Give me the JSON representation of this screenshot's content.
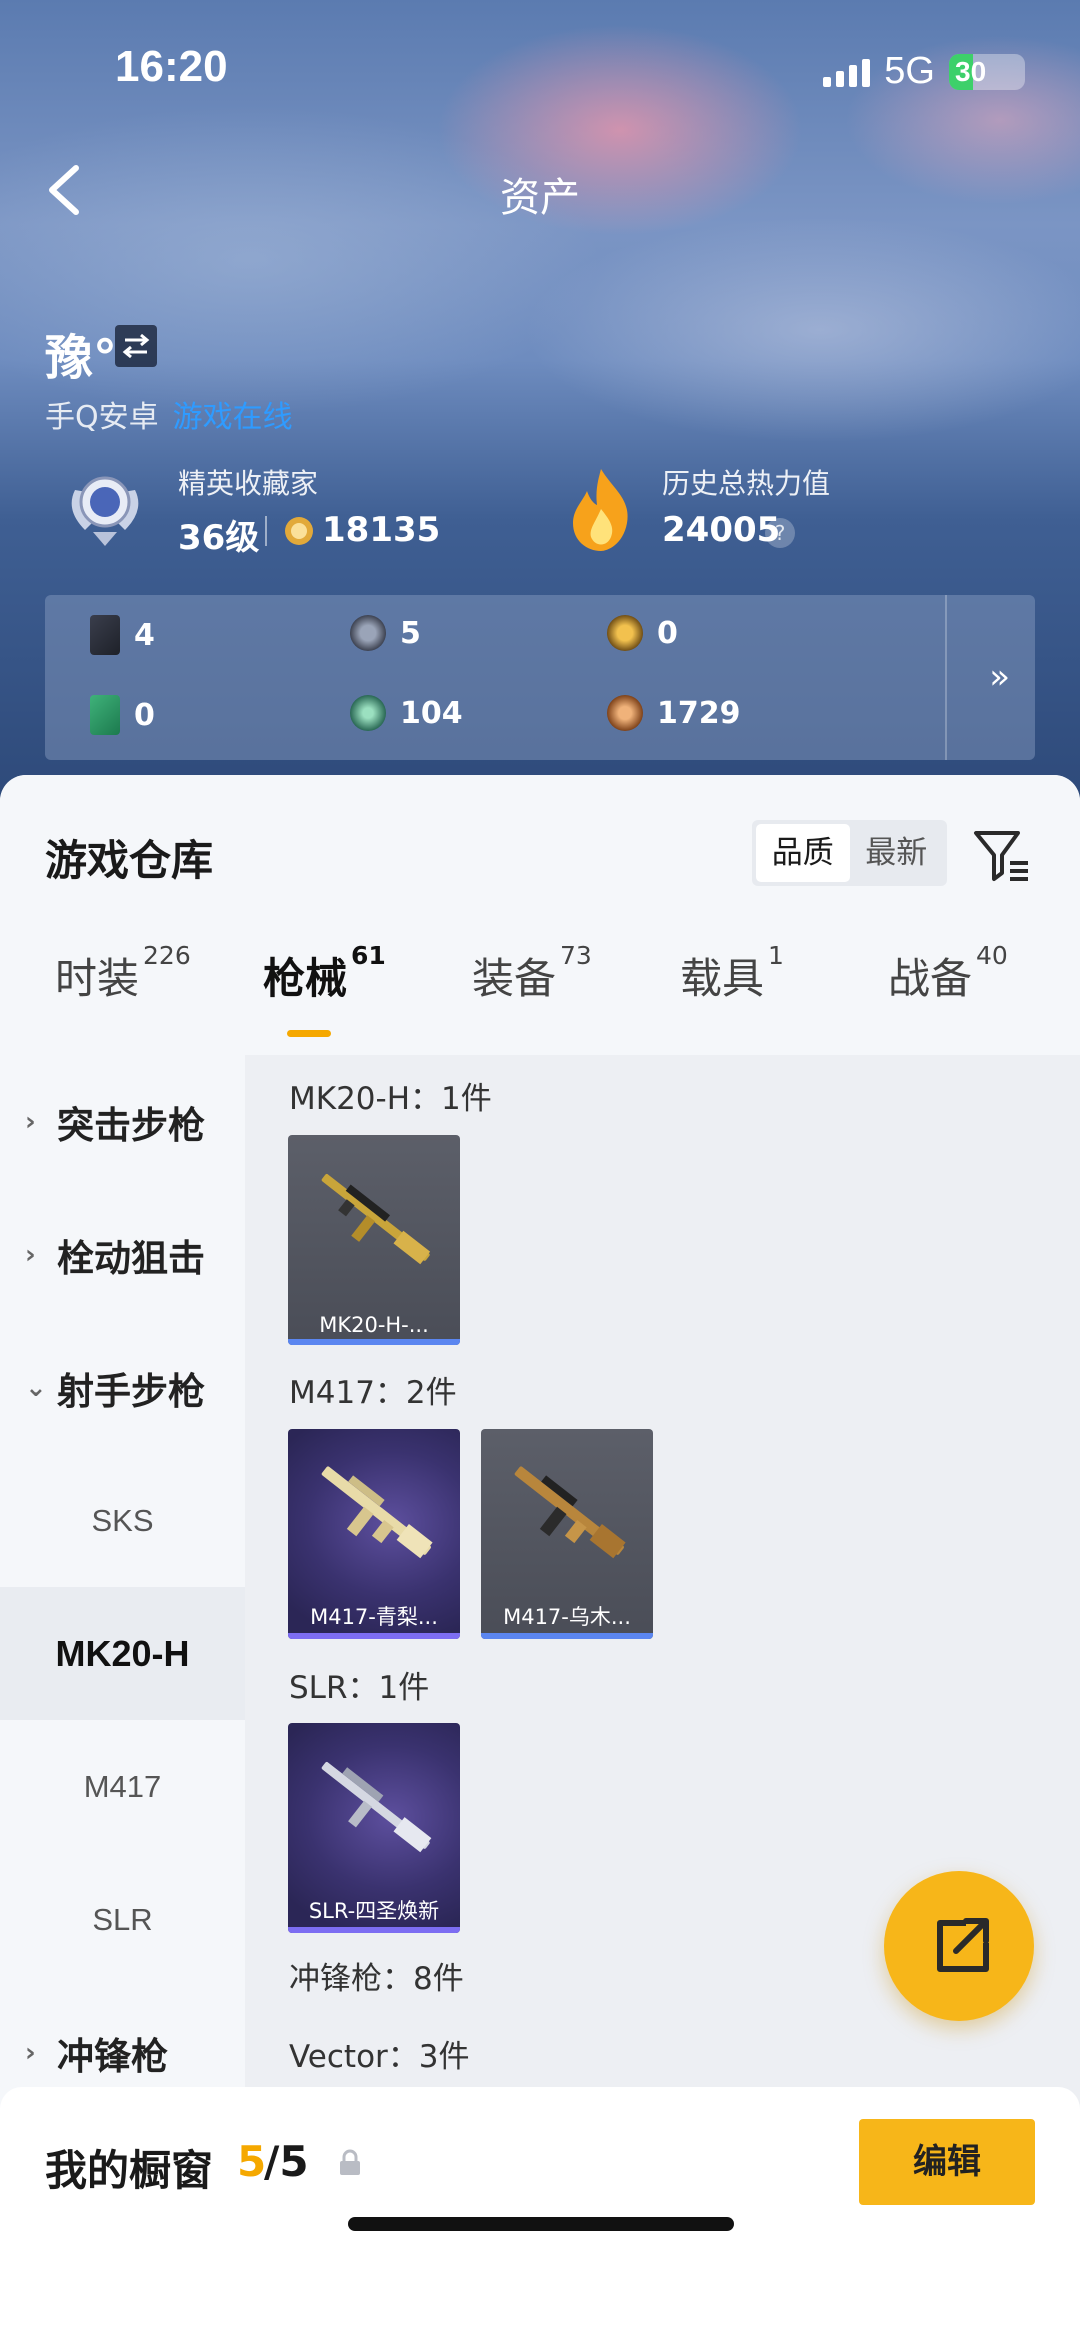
{
  "status_bar": {
    "time": "16:20",
    "network": "5G",
    "battery": "30"
  },
  "header": {
    "title": "资产"
  },
  "user": {
    "name": "豫°",
    "platform": "手Q安卓",
    "online_status": "游戏在线"
  },
  "collector": {
    "label": "精英收藏家",
    "level": "36级",
    "points": "18135"
  },
  "heat": {
    "label": "历史总热力值",
    "value": "24005",
    "help": "?"
  },
  "stats": [
    {
      "icon": "card-grey-icon",
      "value": "4"
    },
    {
      "icon": "silver-medal-icon",
      "value": "5"
    },
    {
      "icon": "gold-medal-icon",
      "value": "0"
    },
    {
      "icon": "card-green-icon",
      "value": "0"
    },
    {
      "icon": "green-orb-icon",
      "value": "104"
    },
    {
      "icon": "bronze-medal-icon",
      "value": "1729"
    }
  ],
  "stats_more": "»",
  "warehouse": {
    "title": "游戏仓库",
    "sort_options": [
      "品质",
      "最新"
    ],
    "sort_selected": "品质"
  },
  "tabs": [
    {
      "label": "时装",
      "count": "226"
    },
    {
      "label": "枪械",
      "count": "61"
    },
    {
      "label": "装备",
      "count": "73"
    },
    {
      "label": "载具",
      "count": "1"
    },
    {
      "label": "战备",
      "count": "40"
    }
  ],
  "active_tab": "枪械",
  "sidebar": {
    "assault": "突击步枪",
    "bolt": "栓动狙击",
    "marksman": "射手步枪",
    "sks": "SKS",
    "mk20": "MK20-H",
    "m417": "M417",
    "slr": "SLR",
    "smg": "冲锋枪"
  },
  "groups": {
    "mk20": "MK20-H：1件",
    "m417": "M417：2件",
    "slr": "SLR：1件",
    "smg": "冲锋枪：8件",
    "vector": "Vector：3件"
  },
  "items": {
    "mk20_1": "MK20-H-...",
    "m417_1": "M417-青梨...",
    "m417_2": "M417-乌木...",
    "slr_1": "SLR-四圣焕新"
  },
  "showcase": {
    "label": "我的橱窗",
    "count": "5",
    "total": "/5",
    "edit_label": "编辑"
  },
  "colors": {
    "accent": "#f7b619",
    "online": "#2f9bff",
    "highlight": "#f5a800"
  }
}
